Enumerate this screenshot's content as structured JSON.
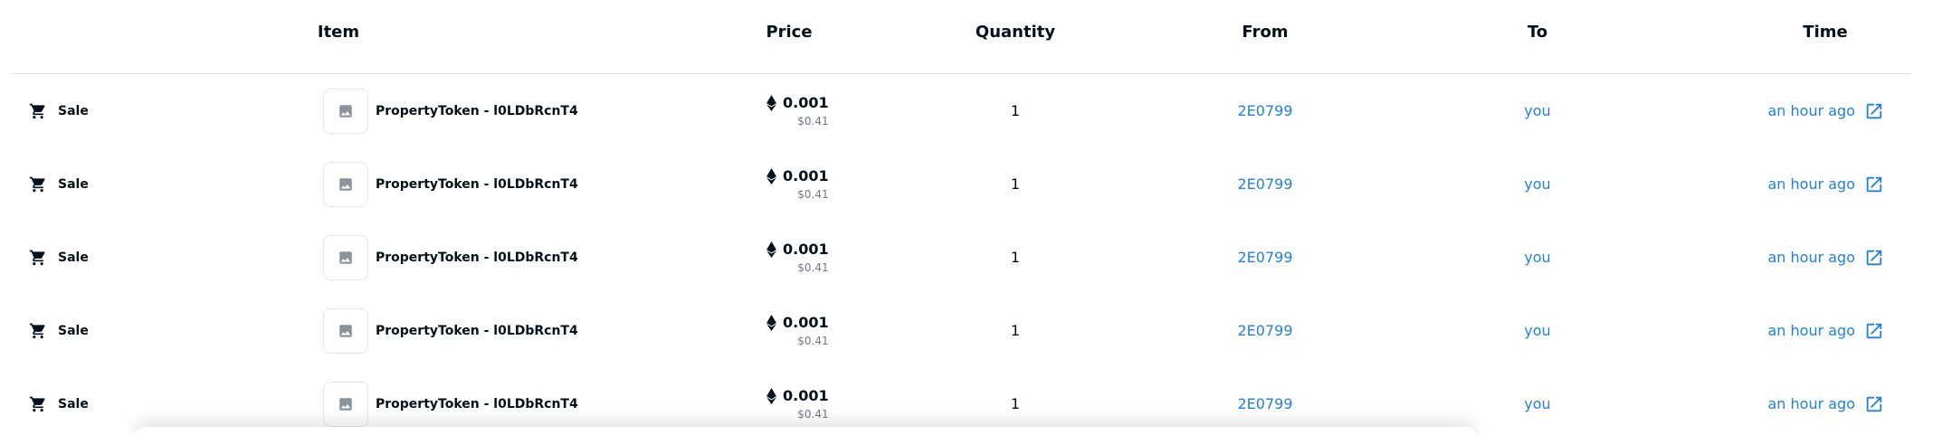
{
  "header": {
    "item": "Item",
    "price": "Price",
    "quantity": "Quantity",
    "from": "From",
    "to": "To",
    "time": "Time"
  },
  "colors": {
    "text": "#04111d",
    "muted": "#707a83",
    "link": "#2081e2",
    "border": "#e5e8eb"
  },
  "rows": [
    {
      "event": "Sale",
      "event_icon": "cart-icon",
      "item": "PropertyToken - l0LDbRcnT4",
      "price": "0.001",
      "price_usd": "$0.41",
      "quantity": "1",
      "from": "2E0799",
      "to": "you",
      "time": "an hour ago"
    },
    {
      "event": "Sale",
      "event_icon": "cart-icon",
      "item": "PropertyToken - l0LDbRcnT4",
      "price": "0.001",
      "price_usd": "$0.41",
      "quantity": "1",
      "from": "2E0799",
      "to": "you",
      "time": "an hour ago"
    },
    {
      "event": "Sale",
      "event_icon": "cart-icon",
      "item": "PropertyToken - l0LDbRcnT4",
      "price": "0.001",
      "price_usd": "$0.41",
      "quantity": "1",
      "from": "2E0799",
      "to": "you",
      "time": "an hour ago"
    },
    {
      "event": "Sale",
      "event_icon": "cart-icon",
      "item": "PropertyToken - l0LDbRcnT4",
      "price": "0.001",
      "price_usd": "$0.41",
      "quantity": "1",
      "from": "2E0799",
      "to": "you",
      "time": "an hour ago"
    },
    {
      "event": "Sale",
      "event_icon": "cart-icon",
      "item": "PropertyToken - l0LDbRcnT4",
      "price": "0.001",
      "price_usd": "$0.41",
      "quantity": "1",
      "from": "2E0799",
      "to": "you",
      "time": "an hour ago"
    }
  ]
}
